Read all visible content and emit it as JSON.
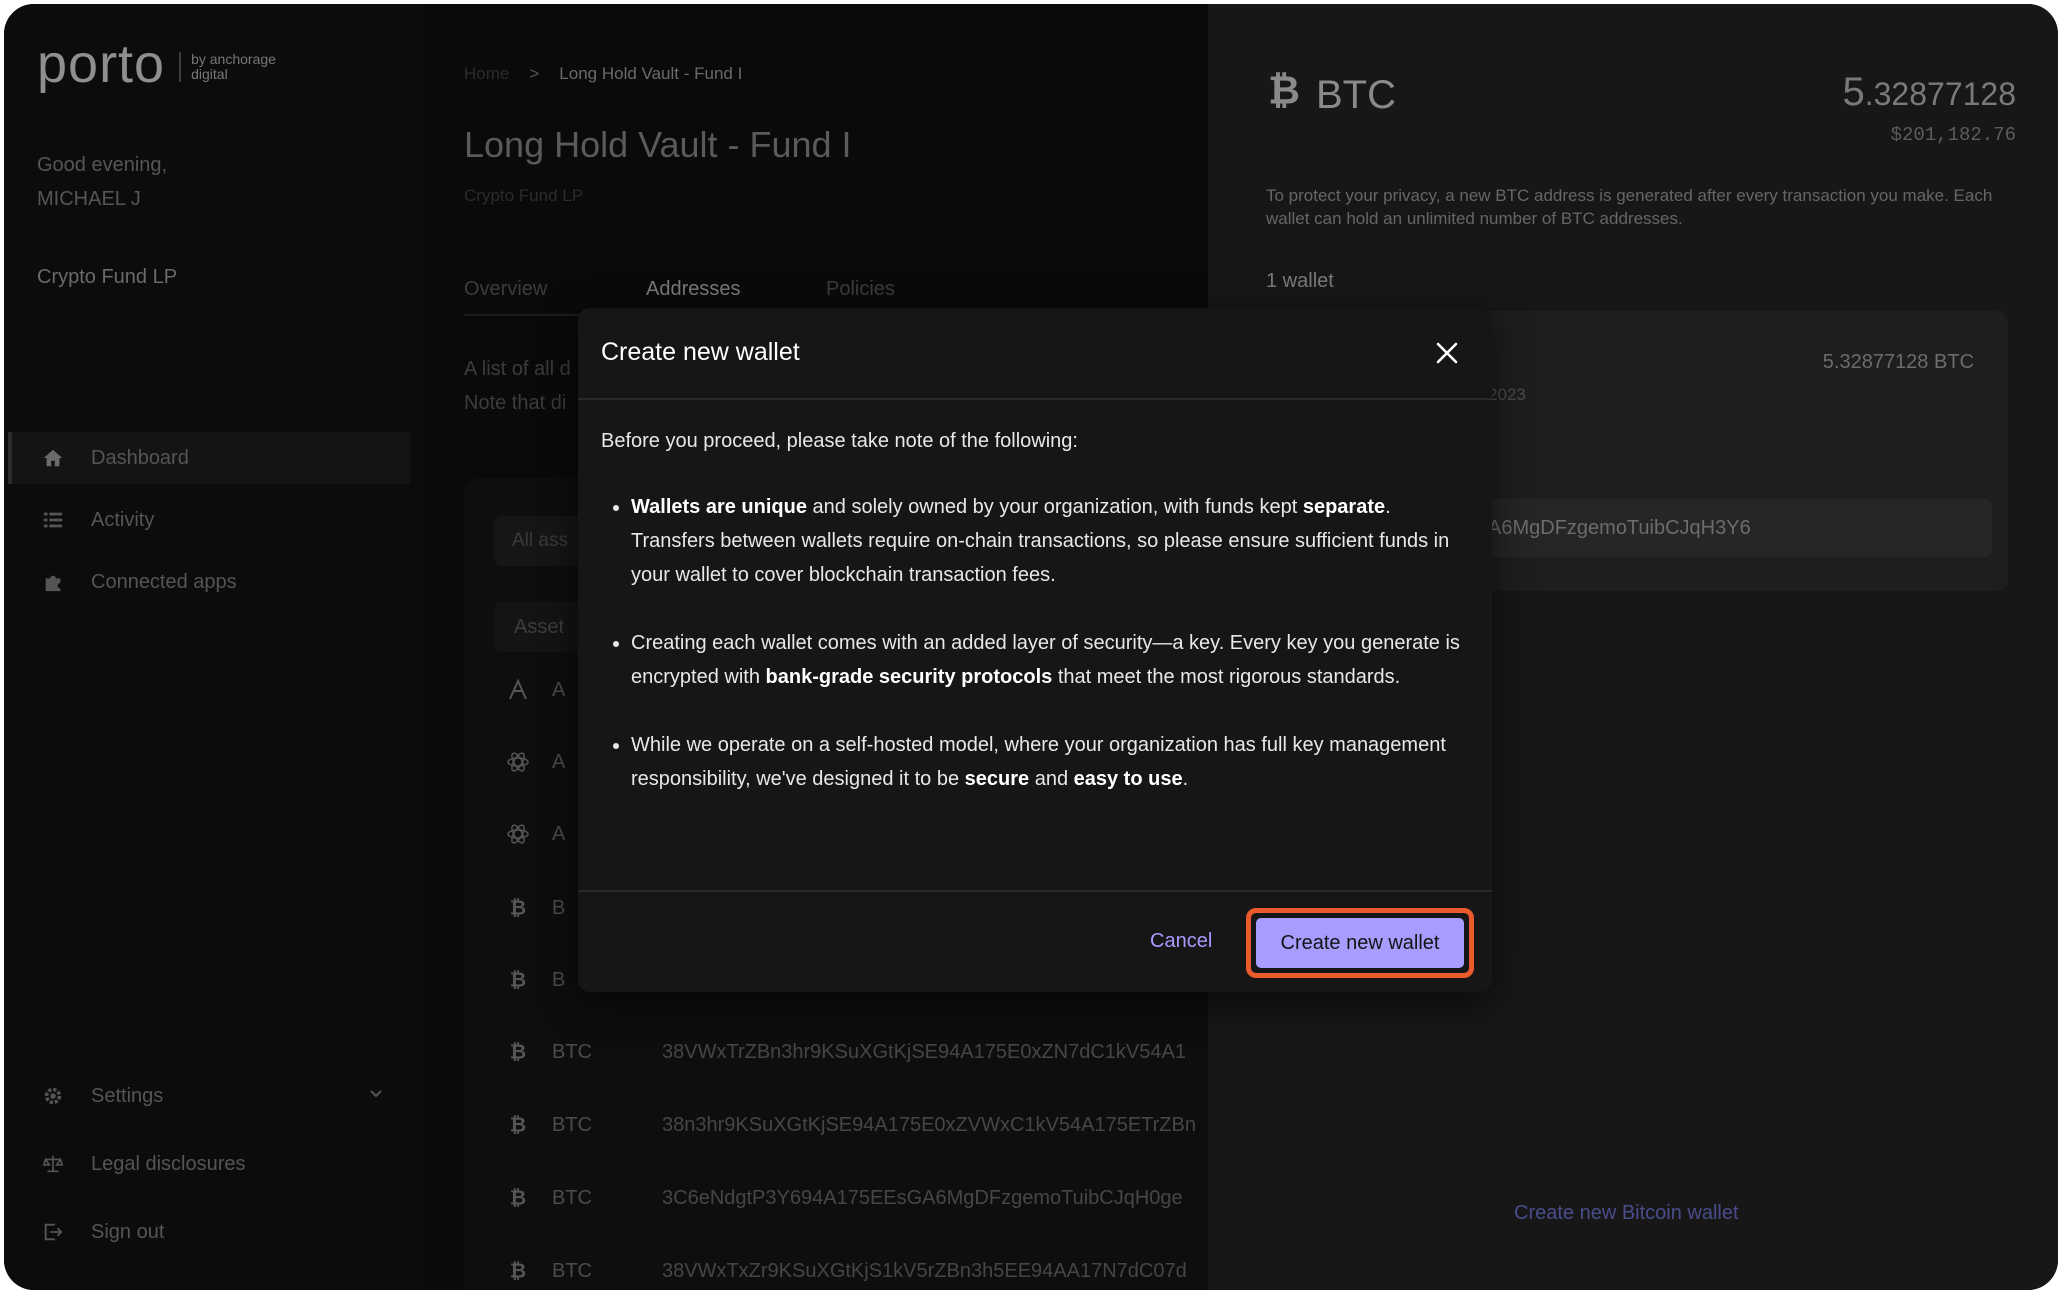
{
  "sidebar": {
    "logo_word": "porto",
    "logo_sub": "by anchorage digital",
    "greeting_line1": "Good evening,",
    "greeting_line2": "MICHAEL J",
    "org_name": "Crypto Fund LP",
    "nav": [
      {
        "label": "Dashboard",
        "icon": "home-icon"
      },
      {
        "label": "Activity",
        "icon": "list-icon"
      },
      {
        "label": "Connected apps",
        "icon": "puzzle-icon"
      }
    ],
    "bottom_nav": [
      {
        "label": "Settings",
        "icon": "gear-icon"
      },
      {
        "label": "Legal disclosures",
        "icon": "scale-icon"
      },
      {
        "label": "Sign out",
        "icon": "sign-out-icon"
      }
    ]
  },
  "main": {
    "breadcrumb_home": "Home",
    "breadcrumb_sep": ">",
    "breadcrumb_current": "Long Hold Vault - Fund I",
    "title": "Long Hold Vault - Fund I",
    "subtitle": "Crypto Fund LP",
    "tabs": [
      "Overview",
      "Addresses",
      "Policies"
    ],
    "description_line1": "A list of all d",
    "description_line2": "Note that di",
    "filter_label": "All ass",
    "table_header": "Asset",
    "rows": [
      {
        "icon": "aave-icon",
        "asset": "A",
        "address": ""
      },
      {
        "icon": "atom-icon",
        "asset": "A",
        "address": ""
      },
      {
        "icon": "atom-icon",
        "asset": "A",
        "address": ""
      },
      {
        "icon": "bitcoin-icon",
        "asset": "B",
        "address": ""
      },
      {
        "icon": "bitcoin-icon",
        "asset": "B",
        "address": ""
      },
      {
        "icon": "bitcoin-icon",
        "asset": "BTC",
        "address": "38VWxTrZBn3hr9KSuXGtKjSE94A175E0xZN7dC1kV54A1"
      },
      {
        "icon": "bitcoin-icon",
        "asset": "BTC",
        "address": "38n3hr9KSuXGtKjSE94A175E0xZVWxC1kV54A175ETrZBn"
      },
      {
        "icon": "bitcoin-icon",
        "asset": "BTC",
        "address": "3C6eNdgtP3Y694A175EEsGA6MgDFzgemoTuibCJqH0ge"
      },
      {
        "icon": "bitcoin-icon",
        "asset": "BTC",
        "address": "38VWxTxZr9KSuXGtKjS1kV5rZBn3h5EE94AA17N7dC07d"
      }
    ]
  },
  "right": {
    "asset": "BTC",
    "amount_int": "5",
    "amount_dec": ".32877128",
    "usd": "$201,182.76",
    "privacy_text": "To protect your privacy, a new BTC address is generated after every transaction you make. Each wallet can hold an unlimited number of BTC addresses.",
    "wallet_count": "1 wallet",
    "wallet_balance": "5.32877128 BTC",
    "wallet_date": "2023",
    "wallet_address": "A6MgDFzgemoTuibCJqH3Y6",
    "create_link": "Create new Bitcoin wallet"
  },
  "modal": {
    "title": "Create new wallet",
    "intro": "Before you proceed, please take note of the following:",
    "b1_bold1": "Wallets are unique",
    "b1_text1": " and solely owned by your organization, with funds kept ",
    "b1_bold2": "separate",
    "b1_text2": ". Transfers between wallets require on-chain transactions, so please ensure sufficient funds in your wallet to cover blockchain transaction fees.",
    "b2_text1": "Creating each wallet comes with an added layer of security—a key. Every key you generate is encrypted with ",
    "b2_bold1": "bank-grade security protocols",
    "b2_text2": " that meet the most rigorous standards.",
    "b3_text1": "While we operate on a self-hosted model, where your organization has full key management responsibility, we've designed it to be ",
    "b3_bold1": "secure",
    "b3_text2": " and ",
    "b3_bold2": "easy to use",
    "b3_text3": ".",
    "cancel_label": "Cancel",
    "create_label": "Create new wallet"
  },
  "colors": {
    "accent": "#a89cff",
    "highlight_ring": "#ea5a2c",
    "modal_bg": "#161616",
    "app_bg": "#0b0b0b"
  }
}
